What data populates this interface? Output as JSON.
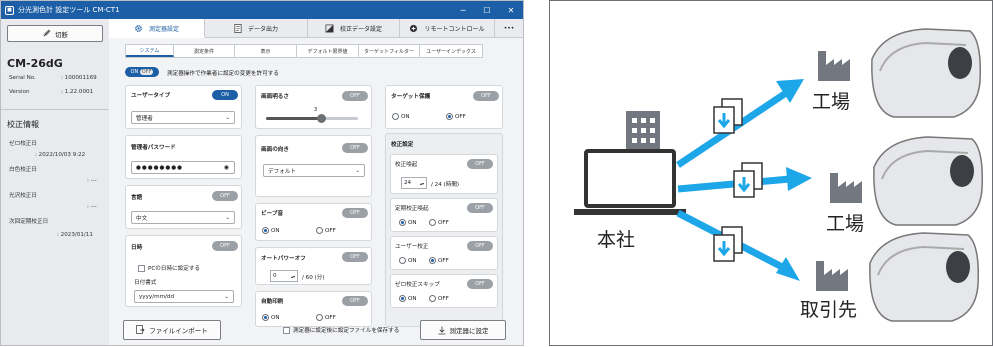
{
  "window": {
    "title": "分光測色計 設定ツール CM-CT1",
    "minimize": "─",
    "maximize": "☐",
    "close": "✕"
  },
  "sidebar": {
    "disconnect_label": "切断",
    "model": "CM-26dG",
    "serial_label": "Serial No.",
    "serial_value": ": 100001169",
    "version_label": "Version",
    "version_value": ": 1.22.0001",
    "cal_title": "校正情報",
    "zero_cal_label": "ゼロ校正日",
    "zero_cal_value": ": 2022/10/03 9:22",
    "white_cal_label": "白色校正日",
    "white_cal_value": ": ---",
    "gloss_cal_label": "光沢校正日",
    "gloss_cal_value": ": ---",
    "next_cal_label": "次回定期校正日",
    "next_cal_value": ": 2023/01/11"
  },
  "tabs": [
    {
      "label": "測定器設定",
      "icon": "gear-icon"
    },
    {
      "label": "データ出力",
      "icon": "document-icon"
    },
    {
      "label": "校正データ設定",
      "icon": "calibration-icon"
    },
    {
      "label": "リモートコントロール",
      "icon": "remote-icon"
    }
  ],
  "tabs_more": "•••",
  "subtabs": [
    "システム",
    "測定条件",
    "表示",
    "デフォルト限界値",
    "ターゲットフィルター",
    "ユーザーインデックス"
  ],
  "allow": {
    "toggle_on": "ON",
    "toggle_off": "OFF",
    "label": "測定器操作で作業者に設定の変更を許可する"
  },
  "user_type": {
    "title": "ユーザータイプ",
    "toggle": "ON",
    "value": "管理者"
  },
  "password": {
    "title": "管理者パスワード",
    "value": "●●●●●●●●"
  },
  "language": {
    "title": "言語",
    "toggle": "OFF",
    "value": "中文"
  },
  "datetime": {
    "title": "日時",
    "toggle": "OFF",
    "pc_label": "PCの日時に設定する",
    "format_title": "日付書式",
    "format_value": "yyyy/mm/dd"
  },
  "brightness": {
    "title": "画面明るさ",
    "toggle": "OFF",
    "value": "3",
    "level": 0.6
  },
  "orientation": {
    "title": "画面の向き",
    "toggle": "OFF",
    "value": "デフォルト"
  },
  "beep": {
    "title": "ビープ音",
    "toggle": "OFF",
    "on": "ON",
    "off": "OFF"
  },
  "autopower": {
    "title": "オートパワーオフ",
    "toggle": "OFF",
    "value": "0",
    "suffix": "/ 60 (分)"
  },
  "autoprint": {
    "title": "自動印刷",
    "toggle": "OFF",
    "on": "ON",
    "off": "OFF"
  },
  "target_protect": {
    "title": "ターゲット保護",
    "toggle": "OFF",
    "on": "ON",
    "off": "OFF"
  },
  "cal_settings": {
    "title": "校正設定",
    "warn_title": "校正喚起",
    "warn_toggle": "OFF",
    "warn_value": "24",
    "warn_suffix": "/ 24 (時間)",
    "periodic_title": "定期校正喚起",
    "periodic_toggle": "OFF",
    "user_cal_title": "ユーザー校正",
    "user_cal_toggle": "OFF",
    "zero_skip_title": "ゼロ校正スキップ",
    "zero_skip_toggle": "OFF",
    "on": "ON",
    "off": "OFF"
  },
  "footer": {
    "import_label": "ファイルインポート",
    "save_after_label": "測定器に設定後に設定ファイルを保存する",
    "apply_label": "測定器に設定"
  },
  "diagram": {
    "hq": "本社",
    "factory1": "工場",
    "factory2": "工場",
    "client": "取引先"
  },
  "colors": {
    "accent": "#1d5fa6",
    "arrow": "#1ea7e8",
    "building": "#737880"
  }
}
